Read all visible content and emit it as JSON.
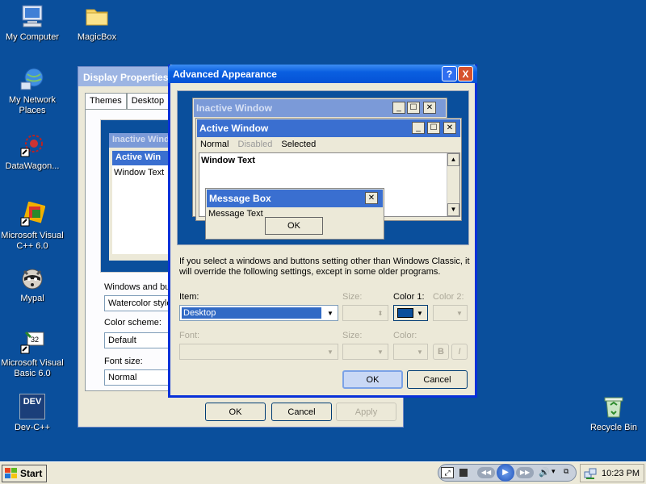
{
  "desktop": {
    "icons": [
      {
        "label": "My Computer"
      },
      {
        "label": "MagicBox"
      },
      {
        "label": "My Network Places"
      },
      {
        "label": "DataWagon..."
      },
      {
        "label": "Microsoft Visual C++ 6.0"
      },
      {
        "label": "Mypal"
      },
      {
        "label": "Microsoft Visual Basic 6.0"
      },
      {
        "label": "Dev-C++"
      },
      {
        "label": "Recycle Bin"
      }
    ],
    "dev_badge": "DEV"
  },
  "display_properties": {
    "title": "Display Properties",
    "tabs": [
      "Themes",
      "Desktop"
    ],
    "preview": {
      "inactive": "Inactive Wind",
      "active": "Active Win",
      "text": "Window Text"
    },
    "windows_buttons_label": "Windows and butto",
    "windows_buttons_value": "Watercolor style",
    "color_scheme_label": "Color scheme:",
    "color_scheme_value": "Default",
    "font_size_label": "Font size:",
    "font_size_value": "Normal",
    "buttons": {
      "ok": "OK",
      "cancel": "Cancel",
      "apply": "Apply"
    }
  },
  "advanced": {
    "title": "Advanced Appearance",
    "help": "?",
    "close": "X",
    "preview": {
      "inactive_title": "Inactive Window",
      "active_title": "Active Window",
      "menu": [
        "Normal",
        "Disabled",
        "Selected"
      ],
      "window_text": "Window Text",
      "msgbox_title": "Message Box",
      "msgbox_text": "Message Text",
      "msgbox_ok": "OK"
    },
    "info": "If you select a windows and buttons setting other than Windows Classic, it will override the following settings, except in some older programs.",
    "item_label": "Item:",
    "item_value": "Desktop",
    "size_label": "Size:",
    "color1_label": "Color 1:",
    "color2_label": "Color 2:",
    "font_label": "Font:",
    "font_size_label": "Size:",
    "font_color_label": "Color:",
    "bold": "B",
    "italic": "I",
    "ok": "OK",
    "cancel": "Cancel",
    "color1": "#0a4f9c"
  },
  "taskbar": {
    "start": "Start",
    "clock": "10:23 PM"
  }
}
